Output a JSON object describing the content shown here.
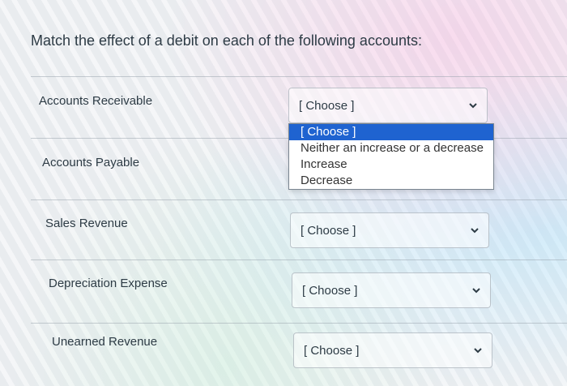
{
  "question": {
    "prompt": "Match the effect of a debit on each of the following accounts:"
  },
  "rows": [
    {
      "label": "Accounts Receivable",
      "selected": "[ Choose ]"
    },
    {
      "label": "Accounts Payable",
      "selected": ""
    },
    {
      "label": "Sales Revenue",
      "selected": "[ Choose ]"
    },
    {
      "label": "Depreciation Expense",
      "selected": "[ Choose ]"
    },
    {
      "label": "Unearned Revenue",
      "selected": "[ Choose ]"
    }
  ],
  "dropdown": {
    "options": [
      "[ Choose ]",
      "Neither an increase or a decrease",
      "Increase",
      "Decrease"
    ],
    "highlighted_index": 0
  },
  "icons": {
    "select_arrow": "chevron-down-icon"
  },
  "colors": {
    "highlight": "#1f63d0"
  }
}
